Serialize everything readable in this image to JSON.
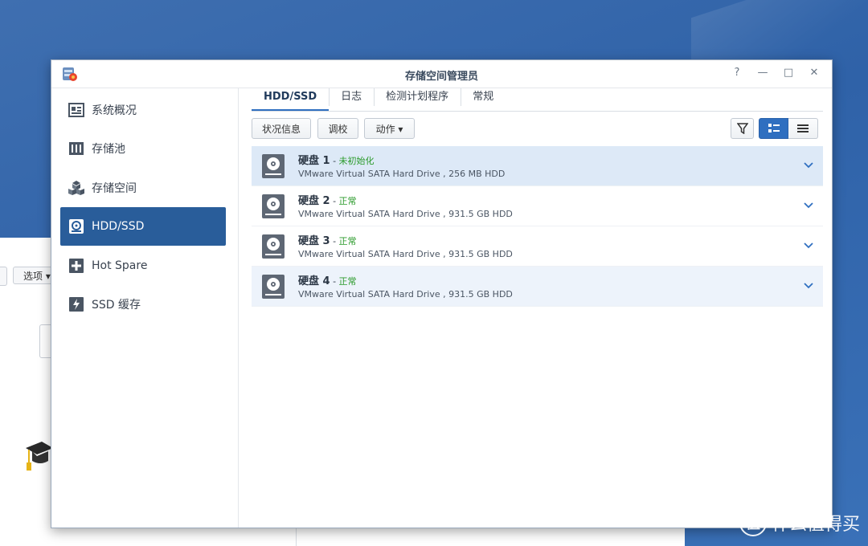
{
  "window": {
    "title": "存储空间管理员",
    "controls": [
      "?",
      "—",
      "□",
      "✕"
    ]
  },
  "background_window": {
    "options_label": "选项"
  },
  "sidebar": {
    "items": [
      {
        "label": "系统概况",
        "icon": "overview-icon",
        "active": false
      },
      {
        "label": "存储池",
        "icon": "storage-pool-icon",
        "active": false
      },
      {
        "label": "存储空间",
        "icon": "volume-icon",
        "active": false
      },
      {
        "label": "HDD/SSD",
        "icon": "hdd-icon",
        "active": true
      },
      {
        "label": "Hot Spare",
        "icon": "hot-spare-icon",
        "active": false
      },
      {
        "label": "SSD 缓存",
        "icon": "ssd-cache-icon",
        "active": false
      }
    ]
  },
  "tabs": [
    {
      "label": "HDD/SSD",
      "active": true
    },
    {
      "label": "日志",
      "active": false
    },
    {
      "label": "检测计划程序",
      "active": false
    },
    {
      "label": "常规",
      "active": false
    }
  ],
  "toolbar": {
    "status_info": "状况信息",
    "calibrate": "调校",
    "action": "动作 ▾"
  },
  "disks": [
    {
      "name": "硬盘 1",
      "sep": " - ",
      "status": "未初始化",
      "desc": "VMware Virtual SATA Hard Drive , 256 MB HDD",
      "style": "sel"
    },
    {
      "name": "硬盘 2",
      "sep": " - ",
      "status": "正常",
      "desc": "VMware Virtual SATA Hard Drive , 931.5 GB HDD",
      "style": "plain"
    },
    {
      "name": "硬盘 3",
      "sep": " - ",
      "status": "正常",
      "desc": "VMware Virtual SATA Hard Drive , 931.5 GB HDD",
      "style": "plain"
    },
    {
      "name": "硬盘 4",
      "sep": " - ",
      "status": "正常",
      "desc": "VMware Virtual SATA Hard Drive , 931.5 GB HDD",
      "style": "alt"
    }
  ],
  "watermark": {
    "logo": "值",
    "text": "什么值得买"
  },
  "colors": {
    "accent": "#295d9a",
    "status_ok": "#2a9a2a",
    "selected_row": "#dde9f7"
  }
}
